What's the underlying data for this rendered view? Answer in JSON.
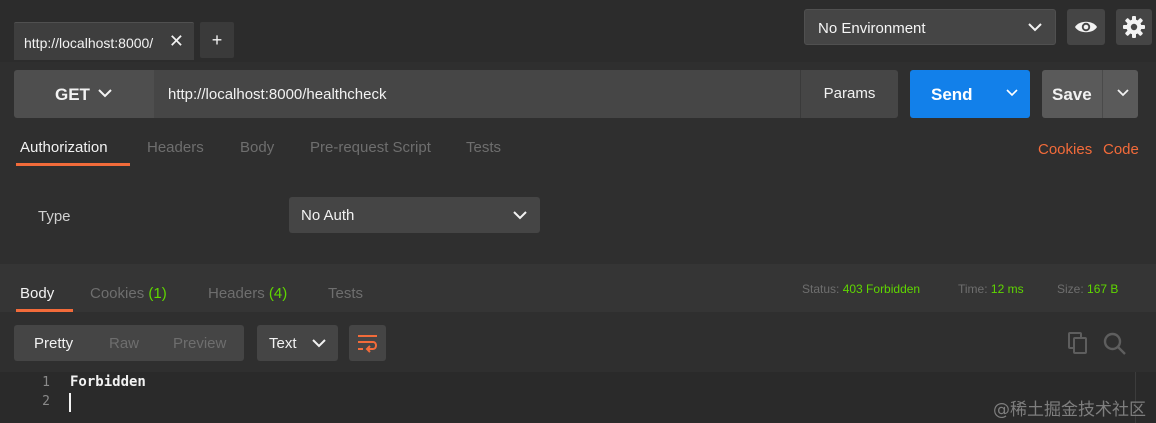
{
  "tabs": {
    "active_title": "http://localhost:8000/",
    "close_glyph": "✕",
    "add_glyph": "+"
  },
  "environment": {
    "selected": "No Environment"
  },
  "request": {
    "method": "GET",
    "url": "http://localhost:8000/healthcheck",
    "params_label": "Params",
    "send_label": "Send",
    "save_label": "Save"
  },
  "request_tabs": {
    "authorization": "Authorization",
    "headers": "Headers",
    "body": "Body",
    "prerequest": "Pre-request Script",
    "tests": "Tests",
    "cookies_link": "Cookies",
    "code_link": "Code"
  },
  "auth": {
    "type_label": "Type",
    "selected": "No Auth"
  },
  "response_tabs": {
    "body": "Body",
    "cookies": "Cookies",
    "cookies_count": "(1)",
    "headers": "Headers",
    "headers_count": "(4)",
    "tests": "Tests"
  },
  "response_meta": {
    "status_label": "Status:",
    "status_value": "403 Forbidden",
    "time_label": "Time:",
    "time_value": "12 ms",
    "size_label": "Size:",
    "size_value": "167 B"
  },
  "response_view": {
    "pretty": "Pretty",
    "raw": "Raw",
    "preview": "Preview",
    "format": "Text"
  },
  "editor": {
    "lines": [
      {
        "number": "1",
        "text": "Forbidden"
      },
      {
        "number": "2",
        "text": ""
      }
    ]
  },
  "watermark": "@稀土掘金技术社区",
  "colors": {
    "accent_orange": "#f26b3a",
    "send_blue": "#1280ea",
    "status_green": "#5fd600"
  }
}
